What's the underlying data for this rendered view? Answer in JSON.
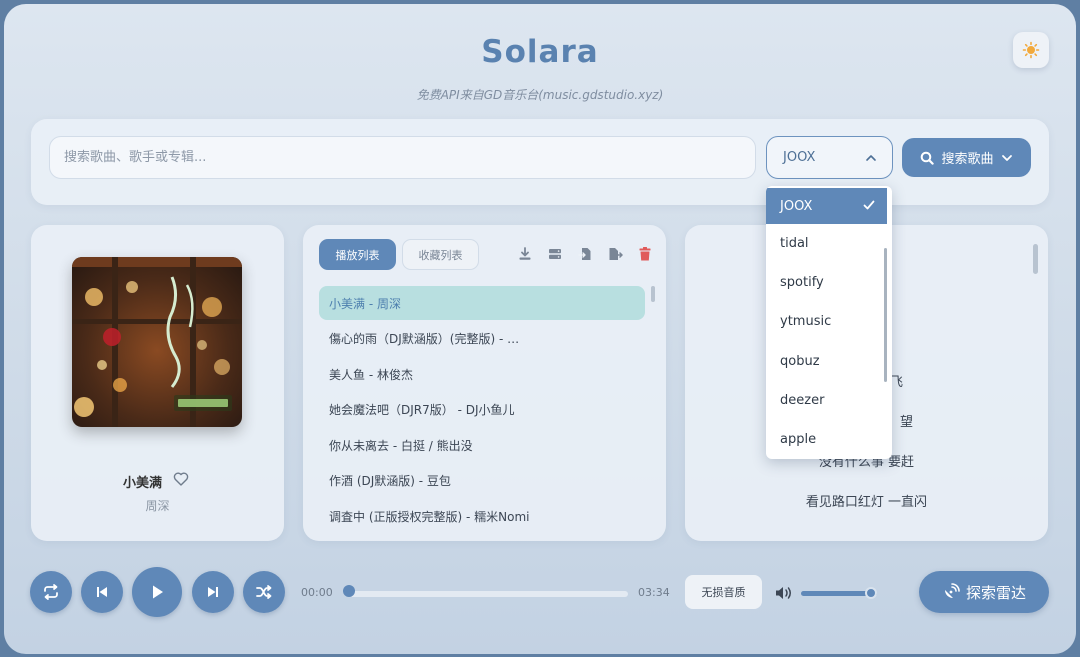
{
  "header": {
    "title": "Solara",
    "subtitle": "免费API来自GD音乐台(music.gdstudio.xyz)"
  },
  "search": {
    "placeholder": "搜索歌曲、歌手或专辑...",
    "value": "",
    "source_selected": "JOOX",
    "button_label": "搜索歌曲"
  },
  "source_dropdown": {
    "options": [
      "JOOX",
      "tidal",
      "spotify",
      "ytmusic",
      "qobuz",
      "deezer",
      "apple"
    ],
    "selected_index": 0
  },
  "now_playing": {
    "title": "小美满",
    "artist": "周深"
  },
  "playlist_panel": {
    "tabs": [
      "播放列表",
      "收藏列表"
    ],
    "active_tab": 0,
    "items": [
      "小美满 - 周深",
      "傷心的雨（DJ默涵版）(完整版) - …",
      "美人鱼 - 林俊杰",
      "她会魔法吧（DJR7版） - DJ小鱼儿",
      "你从未离去 - 白挺 / 熊出没",
      "作酒 (DJ默涵版) - 豆包",
      "调査中 (正版授权完整版) - 糯米Nomi"
    ],
    "active_index": 0
  },
  "lyrics": {
    "visible_lines": [
      "飞",
      "望",
      "没有什么事 要赶",
      "看见路口红灯 一直闪"
    ]
  },
  "player": {
    "current_time": "00:00",
    "duration": "03:34",
    "progress_fraction": 0.0,
    "quality_label": "无损音质",
    "volume_fraction": 0.92,
    "radar_label": "探索雷达"
  },
  "colors": {
    "accent": "#5f88b8",
    "title": "#5a82b0",
    "active_row": "#b8dfe0",
    "delete": "#e05a5a"
  }
}
